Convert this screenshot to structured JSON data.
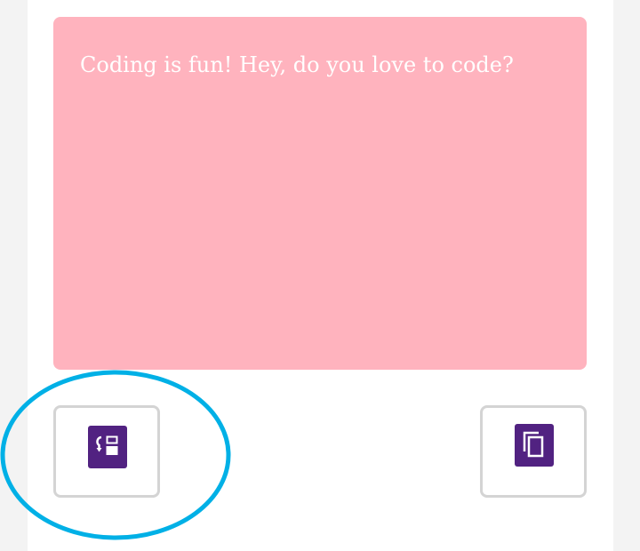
{
  "text_panel": {
    "content": "Coding is fun! Hey, do you love to code?",
    "background": "#ffb3be"
  },
  "buttons": {
    "swap_icon": "swap-layout-icon",
    "copy_icon": "copy-icon",
    "icon_color": "#512281"
  },
  "annotation": {
    "shape": "ellipse",
    "color": "#00b0e6"
  }
}
